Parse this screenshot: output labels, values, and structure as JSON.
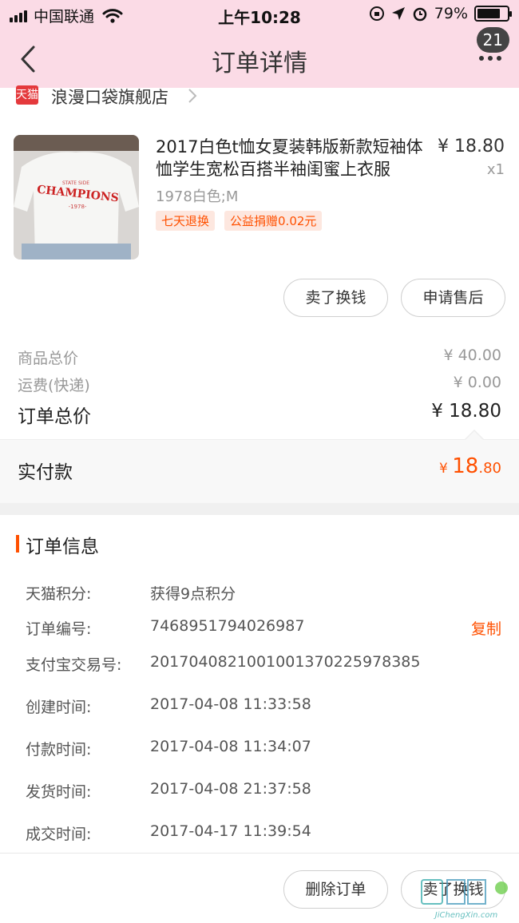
{
  "status_bar": {
    "carrier": "中国联通",
    "time": "上午10:28",
    "battery": "79%",
    "battery_level": 0.79
  },
  "nav": {
    "title": "订单详情",
    "badge_count": "21",
    "icons": [
      "back-icon",
      "more-icon"
    ]
  },
  "shop": {
    "logo_text": "天猫",
    "name": "浪漫口袋旗舰店"
  },
  "product": {
    "title": "2017白色t恤女夏装韩版新款短袖体恤学生宽松百搭半袖闺蜜上衣服",
    "price": "¥ 18.80",
    "quantity": "x1",
    "sku": "1978白色;M",
    "tags": [
      "七天退换",
      "公益捐赠0.02元"
    ],
    "image_text": "CHAMPIONS"
  },
  "actions": {
    "sell_label": "卖了换钱",
    "after_sale_label": "申请售后"
  },
  "summary": {
    "goods_total_label": "商品总价",
    "goods_total": "¥ 40.00",
    "shipping_label": "运费(快递)",
    "shipping": "¥ 0.00",
    "order_total_label": "订单总价",
    "order_total": "¥ 18.80",
    "paid_label": "实付款",
    "paid_currency": "¥ ",
    "paid_int": "18",
    "paid_dec": ".80"
  },
  "order_info": {
    "title": "订单信息",
    "rows": [
      {
        "key": "天猫积分:",
        "value": "获得9点积分"
      },
      {
        "key": "订单编号:",
        "value": "7468951794026987",
        "action": "复制"
      },
      {
        "key": "支付宝交易号:",
        "value": "2017040821001001370225978385"
      },
      {
        "key": "创建时间:",
        "value": "2017-04-08 11:33:58"
      },
      {
        "key": "付款时间:",
        "value": "2017-04-08 11:34:07"
      },
      {
        "key": "发货时间:",
        "value": "2017-04-08 21:37:58"
      },
      {
        "key": "成交时间:",
        "value": "2017-04-17 11:39:54"
      }
    ]
  },
  "bottom": {
    "delete_label": "删除订单",
    "sell_label": "卖了换钱"
  },
  "watermark": {
    "text": "JiChengXin.com"
  },
  "colors": {
    "header_bg": "#fbdbe6",
    "accent": "#ff5000"
  }
}
